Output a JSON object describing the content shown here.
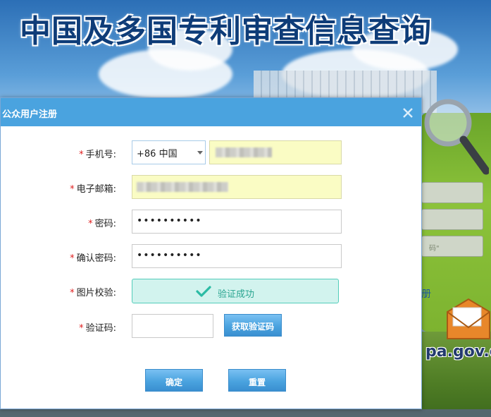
{
  "background": {
    "site_title": "中国及多国专利审查信息查询",
    "domain_text": "pa.gov.cn",
    "side_link": "册",
    "side_hint": "码\""
  },
  "dialog": {
    "title": "公众用户注册",
    "required_mark": "*",
    "fields": {
      "phone": {
        "label": "手机号:",
        "country_code": "+86 中国"
      },
      "email": {
        "label": "电子邮箱:"
      },
      "password": {
        "label": "密码:",
        "value": "••••••••••"
      },
      "confirm_password": {
        "label": "确认密码:",
        "value": "••••••••••"
      },
      "captcha_image": {
        "label": "图片校验:",
        "status_text": "验证成功"
      },
      "sms_code": {
        "label": "验证码:",
        "value": "",
        "button_label": "获取验证码"
      }
    },
    "buttons": {
      "confirm": "确定",
      "reset": "重置"
    }
  },
  "colors": {
    "header": "#4aa3df",
    "required": "#e02020",
    "success": "#2aa591",
    "autofill": "#fafcc4"
  },
  "icons": [
    "close-icon",
    "checkmark-icon",
    "dropdown-caret-icon",
    "magnifier-icon",
    "mail-icon"
  ]
}
